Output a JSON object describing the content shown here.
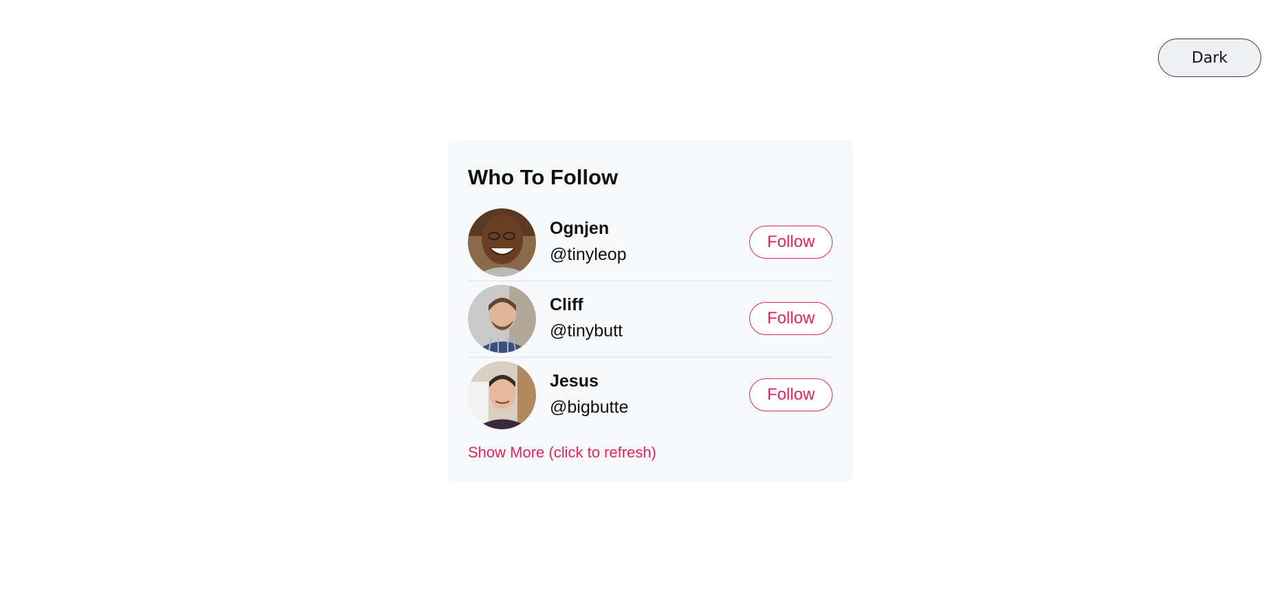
{
  "theme_toggle": {
    "label": "Dark"
  },
  "card": {
    "title": "Who To Follow",
    "users": [
      {
        "name": "Ognjen",
        "handle": "@tinyleop",
        "button": "Follow"
      },
      {
        "name": "Cliff",
        "handle": "@tinybutt",
        "button": "Follow"
      },
      {
        "name": "Jesus",
        "handle": "@bigbutte",
        "button": "Follow"
      }
    ],
    "show_more": "Show More (click to refresh)"
  },
  "colors": {
    "accent": "#e0245e",
    "card_background": "#f7f8fa",
    "toggle_background": "#eef0f3"
  }
}
